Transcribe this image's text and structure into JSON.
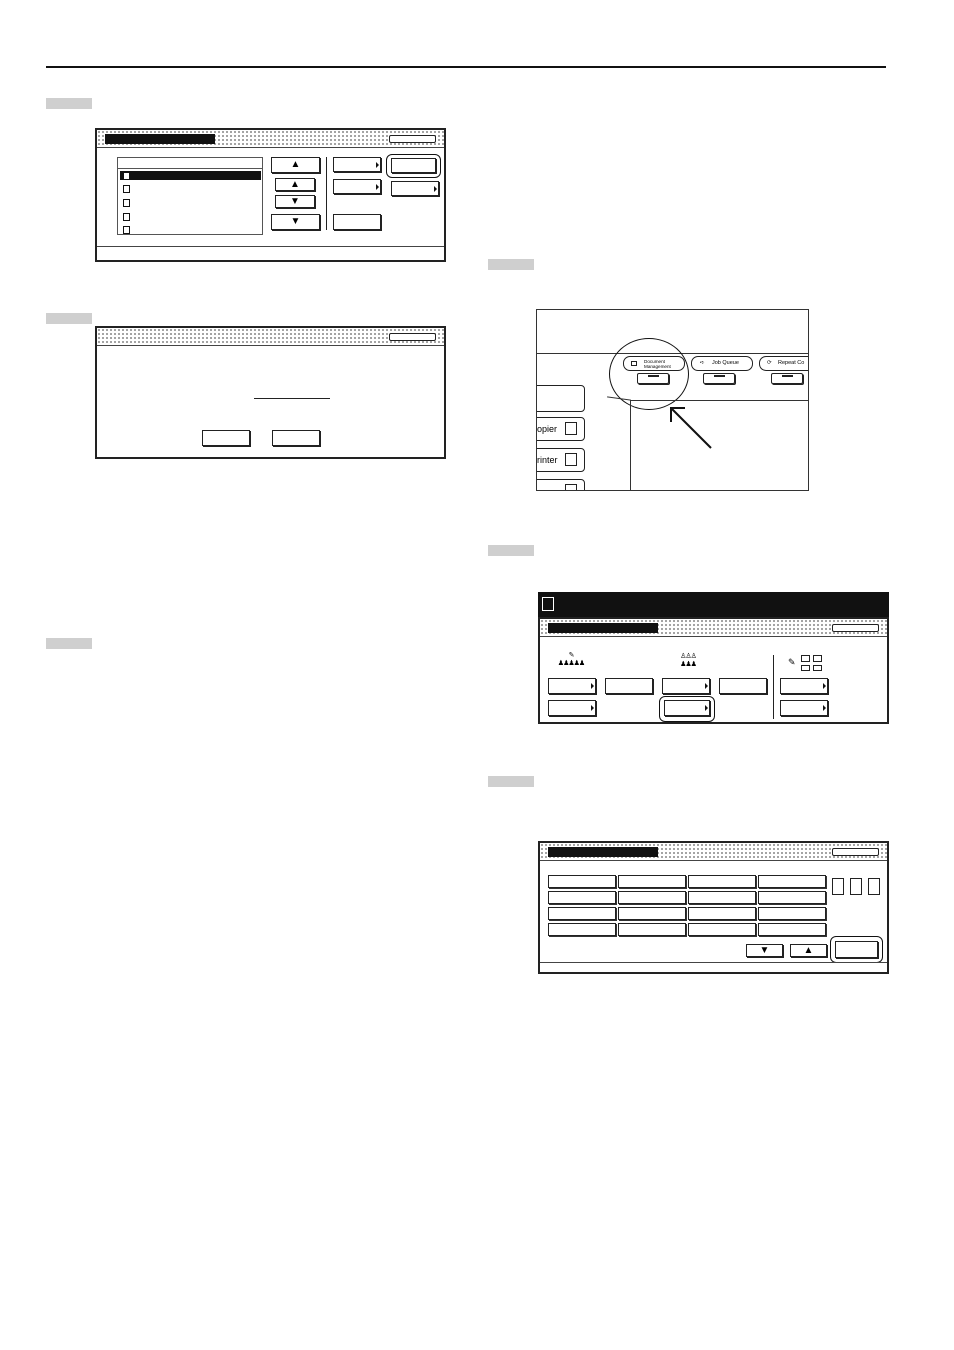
{
  "page": {
    "top_rule": true
  },
  "left_column": {
    "step_markers": 3,
    "screen_a": {
      "list_rows": 5,
      "selected_row": 1,
      "scroll_buttons": [
        "▲",
        "▲",
        "▼",
        "▼"
      ]
    },
    "screen_b": {
      "buttons": 2
    }
  },
  "right_column": {
    "step_markers": 3,
    "control_panel_detail": {
      "tabs": [
        {
          "label": "Document Management",
          "line1": "Document",
          "line2": "Management"
        },
        {
          "label": "Job Queue"
        },
        {
          "label": "Repeat Co"
        }
      ],
      "side_keys": [
        {
          "label": "opier"
        },
        {
          "label": "rinter"
        }
      ]
    },
    "screen_c": {
      "menu_groups": 3
    },
    "screen_d": {
      "grid_rows": 4,
      "grid_cols": 4,
      "nav": [
        "▼",
        "▲"
      ]
    }
  }
}
